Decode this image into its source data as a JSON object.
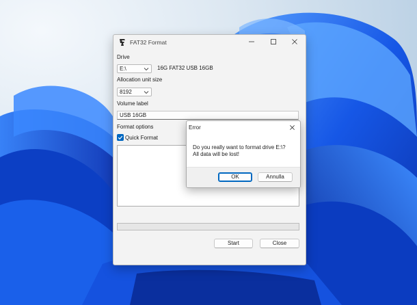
{
  "window": {
    "title": "FAT32 Format",
    "drive": {
      "label": "Drive",
      "selected": "E:\\",
      "info": "16G FAT32 USB 16GB"
    },
    "allocation": {
      "label": "Allocation unit size",
      "selected": "8192"
    },
    "volume": {
      "label": "Volume label",
      "value": "USB 16GB"
    },
    "format_options": {
      "label": "Format options",
      "quick_format_label": "Quick Format",
      "quick_format_checked": true
    },
    "progress": 0,
    "buttons": {
      "start": "Start",
      "close": "Close"
    }
  },
  "dialog": {
    "title": "Error",
    "message_line1": "Do you really want to format drive E:\\?",
    "message_line2": "All data will be lost!",
    "ok_label": "OK",
    "cancel_label": "Annulla"
  },
  "icons": [
    "app-logo-icon",
    "minimize-icon",
    "maximize-icon",
    "close-icon",
    "chevron-down-icon",
    "checkmark-icon"
  ],
  "colors": {
    "accent": "#0067c0",
    "wallpaper_blue": "#0b48d6",
    "window_bg": "#f3f3f3"
  }
}
